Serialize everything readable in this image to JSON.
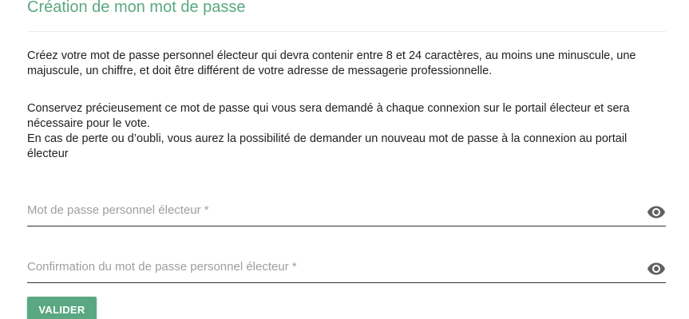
{
  "header": {
    "title": "Création de mon mot de passe"
  },
  "instructions": {
    "paragraph1": "Créez votre mot de passe personnel électeur qui devra contenir entre 8 et 24 caractères, au moins une minuscule, une majuscule, un chiffre, et doit être différent de votre adresse de messagerie professionnelle.",
    "paragraph2": "Conservez précieusement ce mot de passe qui vous sera demandé à chaque connexion sur le portail électeur et sera nécessaire pour le vote.",
    "paragraph3": "En cas de perte ou d’oubli, vous aurez la possibilité de demander un nouveau mot de passe à la connexion au portail électeur"
  },
  "form": {
    "password": {
      "placeholder": "Mot de passe personnel électeur *",
      "value": "",
      "toggle_icon": "eye-icon"
    },
    "confirm": {
      "placeholder": "Confirmation du mot de passe personnel électeur *",
      "value": "",
      "toggle_icon": "eye-icon"
    },
    "submit_label": "VALIDER"
  },
  "colors": {
    "accent": "#5aa882",
    "text": "#212121",
    "placeholder": "#9e9e9e",
    "icon": "#616161"
  }
}
